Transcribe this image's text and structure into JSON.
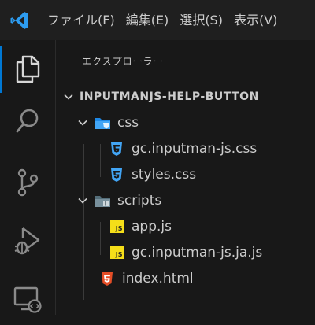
{
  "titlebar": {
    "menu": [
      "ファイル(F)",
      "編集(E)",
      "選択(S)",
      "表示(V)"
    ]
  },
  "activity_bar": {
    "items": [
      {
        "icon": "files-icon",
        "active": true
      },
      {
        "icon": "search-icon",
        "active": false
      },
      {
        "icon": "source-control-icon",
        "active": false
      },
      {
        "icon": "run-debug-icon",
        "active": false
      },
      {
        "icon": "remote-explorer-icon",
        "active": false
      }
    ]
  },
  "explorer": {
    "title": "エクスプローラー",
    "root": "INPUTMANJS-HELP-BUTTON",
    "tree": [
      {
        "label": "css",
        "type": "folder",
        "icon": "css-folder-icon"
      },
      {
        "label": "gc.inputman-js.css",
        "type": "file",
        "icon": "css-file-icon"
      },
      {
        "label": "styles.css",
        "type": "file",
        "icon": "css-file-icon"
      },
      {
        "label": "scripts",
        "type": "folder",
        "icon": "scripts-folder-icon"
      },
      {
        "label": "app.js",
        "type": "file",
        "icon": "js-file-icon"
      },
      {
        "label": "gc.inputman-js.ja.js",
        "type": "file",
        "icon": "js-file-icon"
      },
      {
        "label": "index.html",
        "type": "file",
        "icon": "html-file-icon"
      }
    ],
    "js_badge": "JS"
  },
  "colors": {
    "accent": "#0078d4",
    "css_icon": "#42a5f5",
    "html_icon": "#e44d26",
    "js_icon": "#f5de19"
  }
}
